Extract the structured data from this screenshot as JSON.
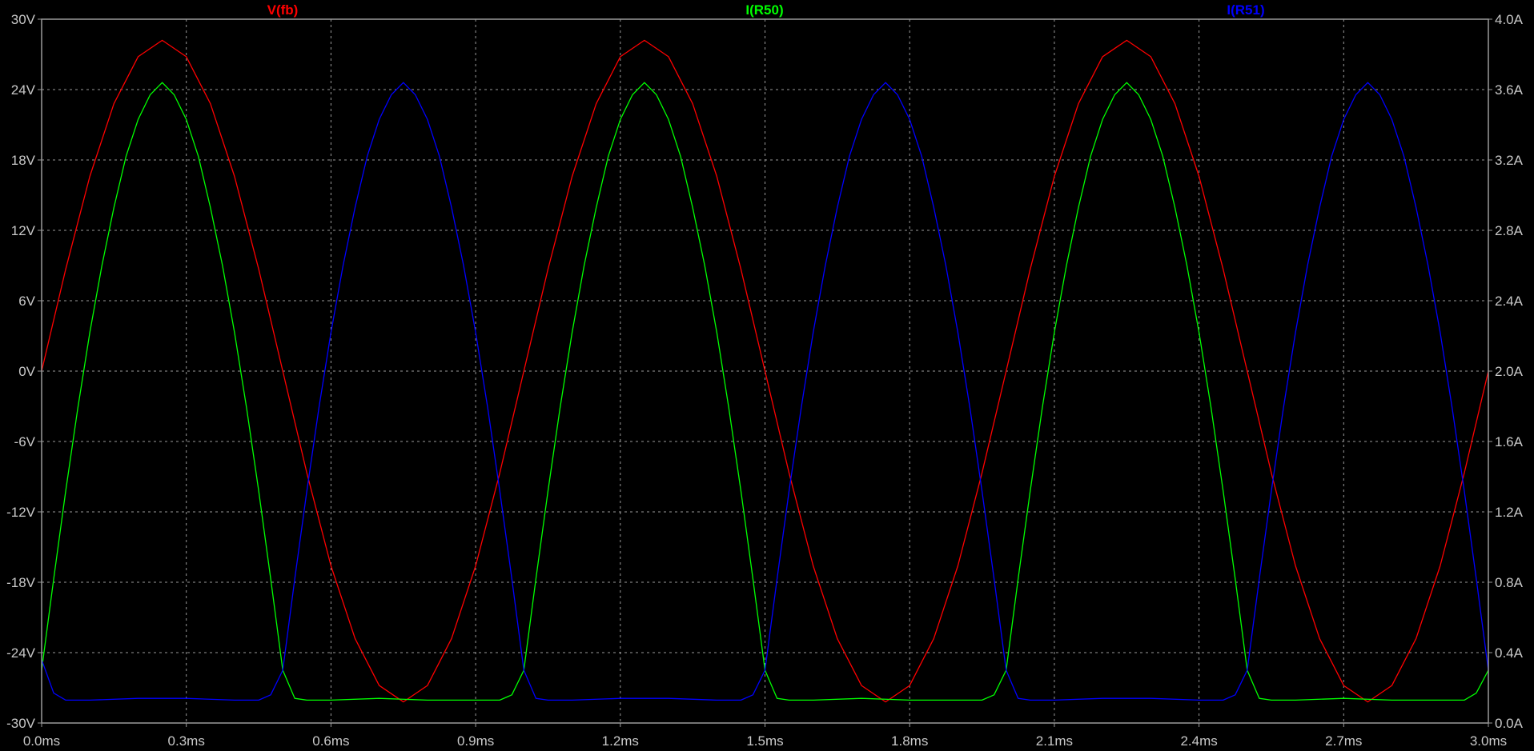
{
  "chart_data": {
    "type": "line",
    "title": "",
    "xlabel": "",
    "ylabel": "",
    "ylabel_right": "",
    "xlim": [
      0.0,
      3.0
    ],
    "ylim": [
      -30,
      30
    ],
    "ylim_right": [
      0.0,
      4.0
    ],
    "grid": true,
    "background": "#000000",
    "x_ticks": [
      0.0,
      0.3,
      0.6,
      0.9,
      1.2,
      1.5,
      1.8,
      2.1,
      2.4,
      2.7,
      3.0
    ],
    "x_tick_labels": [
      "0.0ms",
      "0.3ms",
      "0.6ms",
      "0.9ms",
      "1.2ms",
      "1.5ms",
      "1.8ms",
      "2.1ms",
      "2.4ms",
      "2.7ms",
      "3.0ms"
    ],
    "y_ticks": [
      30,
      24,
      18,
      12,
      6,
      0,
      -6,
      -12,
      -18,
      -24,
      -30
    ],
    "y_tick_labels": [
      "30V",
      "24V",
      "18V",
      "12V",
      "6V",
      "0V",
      "-6V",
      "-12V",
      "-18V",
      "-24V",
      "-30V"
    ],
    "y2_ticks": [
      4.0,
      3.6,
      3.2,
      2.8,
      2.4,
      2.0,
      1.6,
      1.2,
      0.8,
      0.4,
      0.0
    ],
    "y2_tick_labels": [
      "4.0A",
      "3.6A",
      "3.2A",
      "2.8A",
      "2.4A",
      "2.0A",
      "1.6A",
      "1.2A",
      "0.8A",
      "0.4A",
      "0.0A"
    ],
    "series": [
      {
        "name": "V(fb)",
        "axis": "left",
        "color": "#ff0000",
        "x": [
          0.0,
          0.05,
          0.1,
          0.15,
          0.2,
          0.25,
          0.3,
          0.35,
          0.4,
          0.45,
          0.5,
          0.55,
          0.6,
          0.65,
          0.7,
          0.75,
          0.8,
          0.85,
          0.9,
          0.95,
          1.0,
          1.05,
          1.1,
          1.15,
          1.2,
          1.25,
          1.3,
          1.35,
          1.4,
          1.45,
          1.5,
          1.55,
          1.6,
          1.65,
          1.7,
          1.75,
          1.8,
          1.85,
          1.9,
          1.95,
          2.0,
          2.05,
          2.1,
          2.15,
          2.2,
          2.25,
          2.3,
          2.35,
          2.4,
          2.45,
          2.5,
          2.55,
          2.6,
          2.65,
          2.7,
          2.75,
          2.8,
          2.85,
          2.9,
          2.95,
          3.0
        ],
        "y": [
          0.0,
          8.7,
          16.6,
          22.8,
          26.8,
          28.2,
          26.8,
          22.8,
          16.6,
          8.7,
          0.0,
          -8.7,
          -16.6,
          -22.8,
          -26.8,
          -28.2,
          -26.8,
          -22.8,
          -16.6,
          -8.7,
          0.0,
          8.7,
          16.6,
          22.8,
          26.8,
          28.2,
          26.8,
          22.8,
          16.6,
          8.7,
          0.0,
          -8.7,
          -16.6,
          -22.8,
          -26.8,
          -28.2,
          -26.8,
          -22.8,
          -16.6,
          -8.7,
          0.0,
          8.7,
          16.6,
          22.8,
          26.8,
          28.2,
          26.8,
          22.8,
          16.6,
          8.7,
          0.0,
          -8.7,
          -16.6,
          -22.8,
          -26.8,
          -28.2,
          -26.8,
          -22.8,
          -16.6,
          -8.7,
          0.0
        ]
      },
      {
        "name": "I(R50)",
        "axis": "right",
        "color": "#00ff00",
        "x": [
          0.0,
          0.025,
          0.05,
          0.075,
          0.1,
          0.125,
          0.15,
          0.175,
          0.2,
          0.225,
          0.25,
          0.275,
          0.3,
          0.325,
          0.35,
          0.375,
          0.4,
          0.425,
          0.45,
          0.475,
          0.5,
          0.525,
          0.55,
          0.6,
          0.7,
          0.8,
          0.9,
          0.95,
          0.975,
          1.0,
          1.025,
          1.05,
          1.075,
          1.1,
          1.125,
          1.15,
          1.175,
          1.2,
          1.225,
          1.25,
          1.275,
          1.3,
          1.325,
          1.35,
          1.375,
          1.4,
          1.425,
          1.45,
          1.475,
          1.5,
          1.525,
          1.55,
          1.6,
          1.7,
          1.8,
          1.9,
          1.95,
          1.975,
          2.0,
          2.025,
          2.05,
          2.075,
          2.1,
          2.125,
          2.15,
          2.175,
          2.2,
          2.225,
          2.25,
          2.275,
          2.3,
          2.325,
          2.35,
          2.375,
          2.4,
          2.425,
          2.45,
          2.475,
          2.5,
          2.525,
          2.55,
          2.6,
          2.7,
          2.8,
          2.9,
          2.95,
          2.975,
          3.0
        ],
        "y": [
          0.3,
          0.82,
          1.32,
          1.79,
          2.22,
          2.6,
          2.93,
          3.22,
          3.43,
          3.57,
          3.64,
          3.57,
          3.43,
          3.22,
          2.93,
          2.6,
          2.22,
          1.79,
          1.32,
          0.82,
          0.3,
          0.14,
          0.13,
          0.13,
          0.14,
          0.13,
          0.13,
          0.13,
          0.16,
          0.3,
          0.82,
          1.32,
          1.79,
          2.22,
          2.6,
          2.93,
          3.22,
          3.43,
          3.57,
          3.64,
          3.57,
          3.43,
          3.22,
          2.93,
          2.6,
          2.22,
          1.79,
          1.32,
          0.82,
          0.3,
          0.14,
          0.13,
          0.13,
          0.14,
          0.13,
          0.13,
          0.13,
          0.16,
          0.3,
          0.82,
          1.32,
          1.79,
          2.22,
          2.6,
          2.93,
          3.22,
          3.43,
          3.57,
          3.64,
          3.57,
          3.43,
          3.22,
          2.93,
          2.6,
          2.22,
          1.79,
          1.32,
          0.82,
          0.3,
          0.14,
          0.13,
          0.13,
          0.14,
          0.13,
          0.13,
          0.13,
          0.17,
          0.3
        ]
      },
      {
        "name": "I(R51)",
        "axis": "right",
        "color": "#0000ff",
        "x": [
          0.0,
          0.025,
          0.05,
          0.1,
          0.2,
          0.3,
          0.4,
          0.45,
          0.475,
          0.5,
          0.525,
          0.55,
          0.575,
          0.6,
          0.625,
          0.65,
          0.675,
          0.7,
          0.725,
          0.75,
          0.775,
          0.8,
          0.825,
          0.85,
          0.875,
          0.9,
          0.925,
          0.95,
          0.975,
          1.0,
          1.025,
          1.05,
          1.1,
          1.2,
          1.3,
          1.4,
          1.45,
          1.475,
          1.5,
          1.525,
          1.55,
          1.575,
          1.6,
          1.625,
          1.65,
          1.675,
          1.7,
          1.725,
          1.75,
          1.775,
          1.8,
          1.825,
          1.85,
          1.875,
          1.9,
          1.925,
          1.95,
          1.975,
          2.0,
          2.025,
          2.05,
          2.1,
          2.2,
          2.3,
          2.4,
          2.45,
          2.475,
          2.5,
          2.525,
          2.55,
          2.575,
          2.6,
          2.625,
          2.65,
          2.675,
          2.7,
          2.725,
          2.75,
          2.775,
          2.8,
          2.825,
          2.85,
          2.875,
          2.9,
          2.925,
          2.95,
          2.975,
          3.0
        ],
        "y": [
          0.36,
          0.17,
          0.13,
          0.13,
          0.14,
          0.14,
          0.13,
          0.13,
          0.16,
          0.3,
          0.82,
          1.32,
          1.79,
          2.22,
          2.6,
          2.93,
          3.22,
          3.43,
          3.57,
          3.64,
          3.57,
          3.43,
          3.22,
          2.93,
          2.6,
          2.22,
          1.79,
          1.32,
          0.82,
          0.3,
          0.14,
          0.13,
          0.13,
          0.14,
          0.14,
          0.13,
          0.13,
          0.16,
          0.3,
          0.82,
          1.32,
          1.79,
          2.22,
          2.6,
          2.93,
          3.22,
          3.43,
          3.57,
          3.64,
          3.57,
          3.43,
          3.22,
          2.93,
          2.6,
          2.22,
          1.79,
          1.32,
          0.82,
          0.3,
          0.14,
          0.13,
          0.13,
          0.14,
          0.14,
          0.13,
          0.13,
          0.16,
          0.3,
          0.82,
          1.32,
          1.79,
          2.22,
          2.6,
          2.93,
          3.22,
          3.43,
          3.57,
          3.64,
          3.57,
          3.43,
          3.22,
          2.93,
          2.6,
          2.22,
          1.79,
          1.32,
          0.82,
          0.3
        ]
      }
    ]
  }
}
